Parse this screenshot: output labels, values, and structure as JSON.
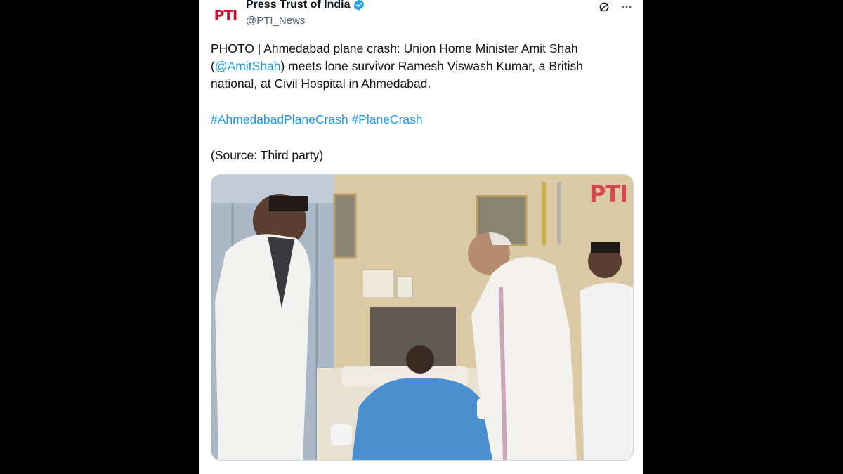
{
  "author": {
    "name": "Press Trust of India",
    "handle": "@PTI_News",
    "avatar_text": "PTI",
    "verified_color": "#1d9bf0"
  },
  "header_icons": [
    "grok-icon",
    "more-icon"
  ],
  "tweet": {
    "line1_prefix": "PHOTO | Ahmedabad plane crash: Union Home Minister Amit Shah (",
    "mention": "@AmitShah",
    "line1_suffix": ") meets lone survivor Ramesh Viswash Kumar, a British national, at Civil Hospital in Ahmedabad.",
    "hashtags": [
      "#AhmedabadPlaneCrash",
      "#PlaneCrash"
    ],
    "source": "(Source: Third party)"
  },
  "photo": {
    "watermark": "PTI"
  },
  "colors": {
    "link": "#1d9bf0",
    "text": "#0f1419",
    "muted": "#536471",
    "brand": "#c8102e"
  }
}
